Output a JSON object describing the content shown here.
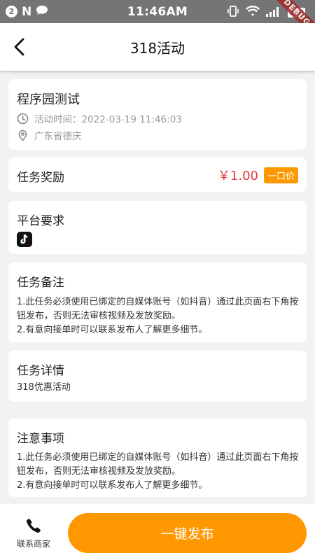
{
  "status_bar": {
    "notification_count": "2",
    "n_icon": "N",
    "time": "11:46AM",
    "battery": "100",
    "debug_label": "DEBUG"
  },
  "app_bar": {
    "title": "318活动"
  },
  "activity": {
    "name": "程序园测试",
    "time_label": "活动时间：2022-03-19 11:46:03",
    "location": "广东省德庆"
  },
  "reward": {
    "label": "任务奖励",
    "amount": "￥1.00",
    "tag": "一口价"
  },
  "platform": {
    "label": "平台要求",
    "icon": "tiktok-icon"
  },
  "remarks": {
    "title": "任务备注",
    "line1": "1.此任务必须使用已绑定的自媒体账号（如抖音）通过此页面右下角按钮发布，否则无法审核视频及发放奖励。",
    "line2": "2.有意向接单时可以联系发布人了解更多细节。"
  },
  "details": {
    "title": "任务详情",
    "text": "318优惠活动"
  },
  "notice": {
    "title": "注意事项",
    "line1": "1.此任务必须使用已绑定的自媒体账号（如抖音）通过此页面右下角按钮发布，否则无法审核视频及发放奖励。",
    "line2": "2.有意向接单时可以联系发布人了解更多细节。"
  },
  "bottom": {
    "contact_label": "联系商家",
    "publish_label": "一键发布"
  },
  "colors": {
    "accent": "#ff9800",
    "price": "#e53935",
    "status_bar": "#757575"
  }
}
